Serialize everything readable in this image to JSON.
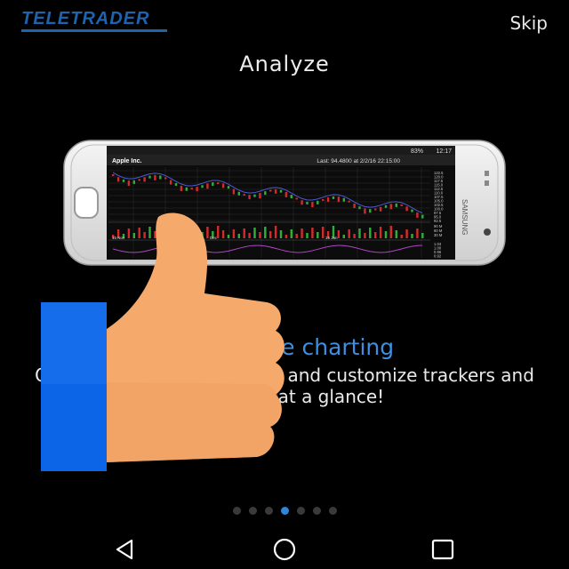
{
  "header": {
    "logo_text": "TELETRADER",
    "skip_label": "Skip"
  },
  "title": "Analyze",
  "feature": {
    "heading": "Interactive charting",
    "description": "Our charts allow you to edit and customize trackers and indicators at a glance!"
  },
  "phone_screen": {
    "status_time": "12:17",
    "status_battery": "83%",
    "stock_name": "Apple Inc.",
    "last_price": "Last: 94.4800 at 2/2/16 22:15:00",
    "price_ticks": [
      "122.5",
      "120.0",
      "117.5",
      "115.0",
      "112.5",
      "110.0",
      "107.5",
      "105.0",
      "102.5",
      "100.0",
      "97.5",
      "95.0",
      "92.5"
    ],
    "volume_ticks": [
      "90 M",
      "60 M",
      "30 M"
    ],
    "indicator_ticks": [
      "1.04",
      "1.00",
      "0.96",
      "0.92"
    ],
    "x_labels": [
      "15 Nov",
      "Dec",
      "15 Jan"
    ],
    "brand": "SAMSUNG"
  },
  "pager": {
    "count": 7,
    "active": 3
  },
  "navbar": {
    "back_icon": "back-triangle-icon",
    "home_icon": "home-circle-icon",
    "recents_icon": "recents-square-icon"
  },
  "colors": {
    "accent": "#3d8fe0",
    "logo": "#1e63ad",
    "thumb_skin": "#f5aa6c",
    "thumb_cuff": "#0c64e6"
  }
}
